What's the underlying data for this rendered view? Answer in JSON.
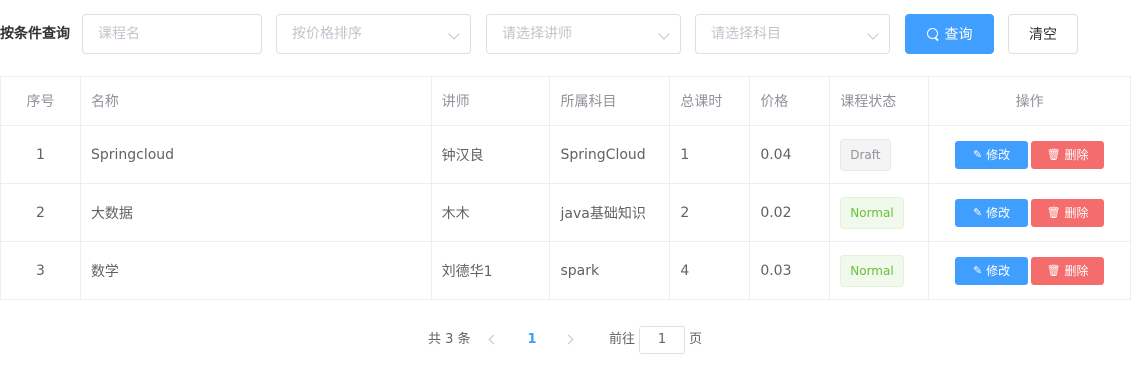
{
  "filter": {
    "label": "按条件查询",
    "course_name_placeholder": "课程名",
    "price_sort_placeholder": "按价格排序",
    "teacher_placeholder": "请选择讲师",
    "subject_placeholder": "请选择科目",
    "search_label": "查询",
    "clear_label": "清空"
  },
  "table": {
    "headers": [
      "序号",
      "名称",
      "讲师",
      "所属科目",
      "总课时",
      "价格",
      "课程状态",
      "操作"
    ],
    "rows": [
      {
        "index": "1",
        "name": "Springcloud",
        "teacher": "钟汉良",
        "subject": "SpringCloud",
        "lessons": "1",
        "price": "0.04",
        "status": "Draft"
      },
      {
        "index": "2",
        "name": "大数据",
        "teacher": "木木",
        "subject": "java基础知识",
        "lessons": "2",
        "price": "0.02",
        "status": "Normal"
      },
      {
        "index": "3",
        "name": "数学",
        "teacher": "刘德华1",
        "subject": "spark",
        "lessons": "4",
        "price": "0.03",
        "status": "Normal"
      }
    ],
    "edit_label": "修改",
    "delete_label": "删除"
  },
  "pagination": {
    "total_text": "共 3 条",
    "current_page": "1",
    "goto_label": "前往",
    "goto_value": "1",
    "page_unit": "页"
  },
  "colors": {
    "primary": "#409eff",
    "danger": "#f56c6c",
    "success": "#67c23a"
  }
}
